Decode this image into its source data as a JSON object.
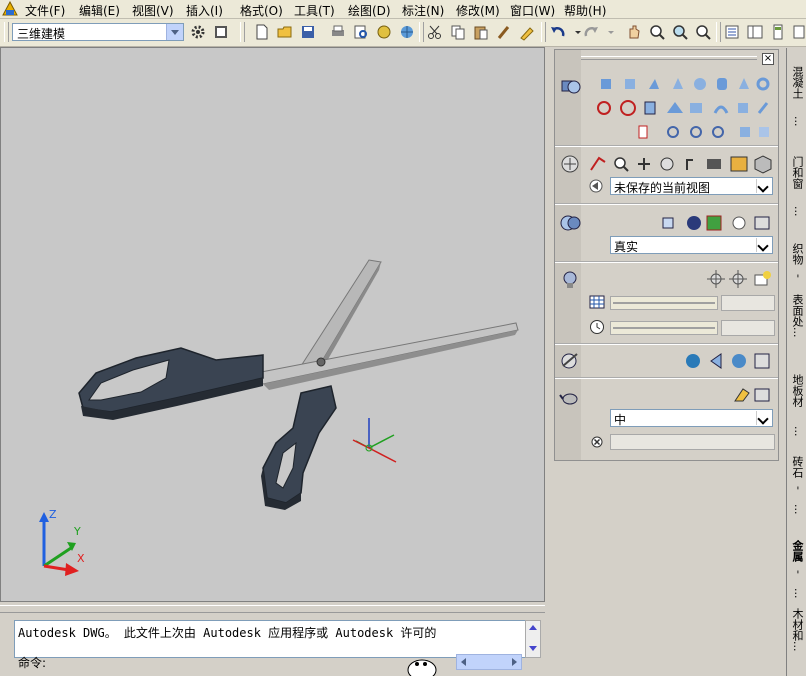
{
  "menu": [
    "文件(F)",
    "编辑(E)",
    "视图(V)",
    "插入(I)",
    "格式(O)",
    "工具(T)",
    "绘图(D)",
    "标注(N)",
    "修改(M)",
    "窗口(W)",
    "帮助(H)"
  ],
  "toolbar": {
    "workspace_value": "三维建模"
  },
  "viewport": {
    "ucs_axes": [
      "Z",
      "Y",
      "X"
    ]
  },
  "command": {
    "history_line": "Autodesk DWG。  此文件上次由 Autodesk 应用程序或 Autodesk 许可的",
    "prompt_label": "命令:"
  },
  "panel": {
    "view_value": "未保存的当前视图",
    "visual_style_value": "真实",
    "quality_value": "中"
  },
  "palette_tabs": [
    "混凝土",
    "...",
    "门和窗",
    "...",
    "织物",
    "-",
    "表面处...",
    "地板材",
    "...",
    "砖石",
    "-",
    "...",
    "金属",
    "-",
    "...",
    "木材和..."
  ],
  "colors": {
    "viewport_bg": "#c8c8c8",
    "handle": "#3a4452",
    "blade": "#b8b8b8",
    "axis_x": "#e02020",
    "axis_y": "#20a020",
    "axis_z": "#2060e0"
  }
}
